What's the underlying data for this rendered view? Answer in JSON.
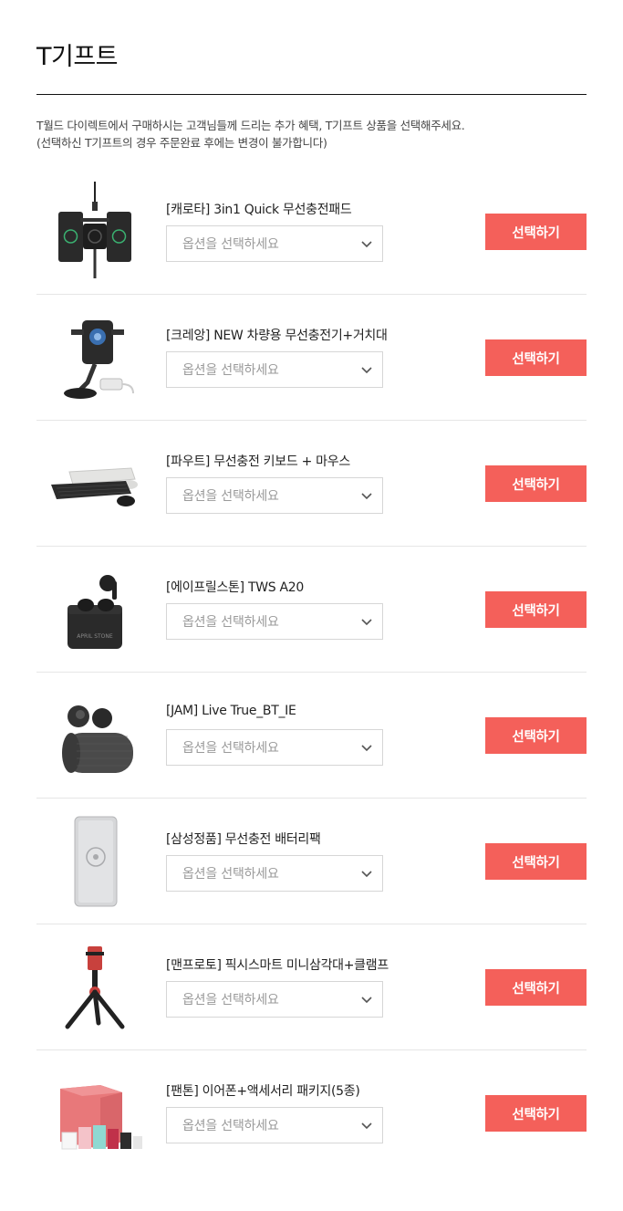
{
  "page": {
    "title": "T기프트",
    "description_line1": "T월드 다이렉트에서 구매하시는 고객님들께 드리는 추가 혜택, T기프트 상품을 선택해주세요.",
    "description_line2": "(선택하신 T기프트의 경우 주문완료 후에는 변경이 불가합니다)"
  },
  "accent_color": "#f4605a",
  "select_placeholder": "옵션을 선택하세요",
  "button_label": "선택하기",
  "gifts": [
    {
      "name": "[캐로타] 3in1 Quick 무선충전패드",
      "option": "옵션을 선택하세요",
      "button": "선택하기",
      "icon": "wireless-charging-pad-icon"
    },
    {
      "name": "[크레앙] NEW 차량용 무선충전기+거치대",
      "option": "옵션을 선택하세요",
      "button": "선택하기",
      "icon": "car-mount-charger-icon"
    },
    {
      "name": "[파우트] 무선충전 키보드 + 마우스",
      "option": "옵션을 선택하세요",
      "button": "선택하기",
      "icon": "keyboard-mouse-icon"
    },
    {
      "name": "[에이프릴스톤] TWS A20",
      "option": "옵션을 선택하세요",
      "button": "선택하기",
      "icon": "earbuds-case-icon"
    },
    {
      "name": "[JAM] Live True_BT_IE",
      "option": "옵션을 선택하세요",
      "button": "선택하기",
      "icon": "earbuds-speaker-icon"
    },
    {
      "name": "[삼성정품] 무선충전 배터리팩",
      "option": "옵션을 선택하세요",
      "button": "선택하기",
      "icon": "battery-pack-icon"
    },
    {
      "name": "[맨프로토] 픽시스마트 미니삼각대+클램프",
      "option": "옵션을 선택하세요",
      "button": "선택하기",
      "icon": "mini-tripod-icon"
    },
    {
      "name": "[팬톤] 이어폰+액세서리 패키지(5종)",
      "option": "옵션을 선택하세요",
      "button": "선택하기",
      "icon": "accessory-package-icon"
    }
  ]
}
